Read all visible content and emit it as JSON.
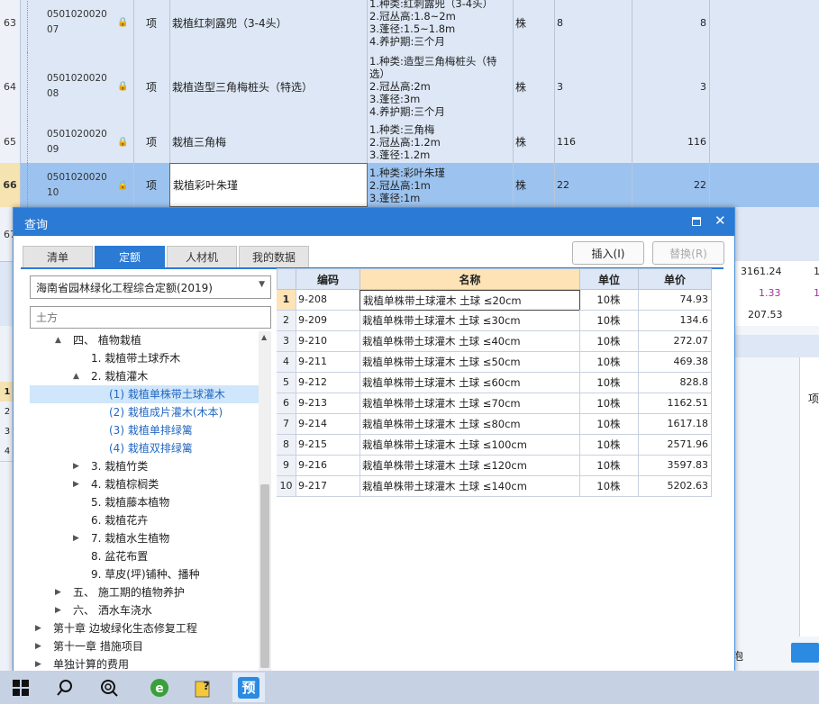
{
  "bg_rows": [
    {
      "num": "63",
      "code": "050102002007",
      "type": "项",
      "name": "栽植红刺露兜（3-4头）",
      "features": [
        "1.种类:红刺露兜（3-4头）",
        "2.冠丛高:1.8~2m",
        "3.蓬径:1.5~1.8m",
        "4.养护期:三个月"
      ],
      "unit": "株",
      "qty1": "8",
      "qty2": "8"
    },
    {
      "num": "64",
      "code": "050102002008",
      "type": "项",
      "name": "栽植造型三角梅桩头（特选）",
      "features": [
        "1.种类:造型三角梅桩头（特",
        "选）",
        "2.冠丛高:2m",
        "3.蓬径:3m",
        "4.养护期:三个月"
      ],
      "unit": "株",
      "qty1": "3",
      "qty2": "3"
    },
    {
      "num": "65",
      "code": "050102002009",
      "type": "项",
      "name": "栽植三角梅",
      "features": [
        "1.种类:三角梅",
        "2.冠丛高:1.2m",
        "3.蓬径:1.2m"
      ],
      "unit": "株",
      "qty1": "116",
      "qty2": "116"
    },
    {
      "num": "66",
      "code": "050102002010",
      "type": "项",
      "name": "栽植彩叶朱瑾",
      "features": [
        "1.种类:彩叶朱瑾",
        "2.冠丛高:1m",
        "3.蓬径:1m"
      ],
      "unit": "株",
      "qty1": "22",
      "qty2": "22"
    }
  ],
  "bg_partial": {
    "row67": "67",
    "right_vals": [
      "3161.24",
      "1.33",
      "207.53"
    ],
    "right_extra": [
      "1",
      "1"
    ],
    "left_nums": [
      "1",
      "2",
      "3",
      "4"
    ],
    "right_label_1": "项",
    "right_label_2": "泡"
  },
  "dialog": {
    "title": "查询",
    "tabs": [
      "清单",
      "定额",
      "人材机",
      "我的数据"
    ],
    "active_tab": "定额",
    "insert_label": "插入(I)",
    "replace_label": "替换(R)",
    "quota_select": "海南省园林绿化工程综合定额(2019)",
    "search_value": "",
    "search_placeholder": "土方",
    "tree": [
      {
        "label": "四、 植物栽植",
        "level": 2,
        "exp": "▲"
      },
      {
        "label": "1. 栽植带土球乔木",
        "level": 3,
        "exp": ""
      },
      {
        "label": "2. 栽植灌木",
        "level": 3,
        "exp": "▲"
      },
      {
        "label": "(1) 栽植单株带土球灌木",
        "level": 4,
        "exp": "",
        "selected": true
      },
      {
        "label": "(2) 栽植成片灌木(木本)",
        "level": 4,
        "exp": ""
      },
      {
        "label": "(3) 栽植单排绿篱",
        "level": 4,
        "exp": ""
      },
      {
        "label": "(4) 栽植双排绿篱",
        "level": 4,
        "exp": ""
      },
      {
        "label": "3. 栽植竹类",
        "level": 3,
        "exp": "▶"
      },
      {
        "label": "4. 栽植棕榈类",
        "level": 3,
        "exp": "▶"
      },
      {
        "label": "5. 栽植藤本植物",
        "level": 3,
        "exp": ""
      },
      {
        "label": "6. 栽植花卉",
        "level": 3,
        "exp": ""
      },
      {
        "label": "7. 栽植水生植物",
        "level": 3,
        "exp": "▶"
      },
      {
        "label": "8. 盆花布置",
        "level": 3,
        "exp": ""
      },
      {
        "label": "9. 草皮(坪)铺种、播种",
        "level": 3,
        "exp": ""
      },
      {
        "label": "五、 施工期的植物养护",
        "level": 2,
        "exp": "▶"
      },
      {
        "label": "六、 洒水车浇水",
        "level": 2,
        "exp": "▶"
      },
      {
        "label": "第十章 边坡绿化生态修复工程",
        "level": 1,
        "exp": "▶"
      },
      {
        "label": "第十一章 措施项目",
        "level": 1,
        "exp": "▶"
      },
      {
        "label": "单独计算的费用",
        "level": 1,
        "exp": "▶"
      }
    ],
    "grid_headers": {
      "code": "编码",
      "name": "名称",
      "unit": "单位",
      "price": "单价"
    },
    "grid_rows": [
      {
        "idx": "1",
        "code": "9-208",
        "name": "栽植单株带土球灌木 土球 ≤20cm",
        "unit": "10株",
        "price": "74.93"
      },
      {
        "idx": "2",
        "code": "9-209",
        "name": "栽植单株带土球灌木 土球 ≤30cm",
        "unit": "10株",
        "price": "134.6"
      },
      {
        "idx": "3",
        "code": "9-210",
        "name": "栽植单株带土球灌木 土球 ≤40cm",
        "unit": "10株",
        "price": "272.07"
      },
      {
        "idx": "4",
        "code": "9-211",
        "name": "栽植单株带土球灌木 土球 ≤50cm",
        "unit": "10株",
        "price": "469.38"
      },
      {
        "idx": "5",
        "code": "9-212",
        "name": "栽植单株带土球灌木 土球 ≤60cm",
        "unit": "10株",
        "price": "828.8"
      },
      {
        "idx": "6",
        "code": "9-213",
        "name": "栽植单株带土球灌木 土球 ≤70cm",
        "unit": "10株",
        "price": "1162.51"
      },
      {
        "idx": "7",
        "code": "9-214",
        "name": "栽植单株带土球灌木 土球 ≤80cm",
        "unit": "10株",
        "price": "1617.18"
      },
      {
        "idx": "8",
        "code": "9-215",
        "name": "栽植单株带土球灌木 土球 ≤100cm",
        "unit": "10株",
        "price": "2571.96"
      },
      {
        "idx": "9",
        "code": "9-216",
        "name": "栽植单株带土球灌木 土球 ≤120cm",
        "unit": "10株",
        "price": "3597.83"
      },
      {
        "idx": "10",
        "code": "9-217",
        "name": "栽植单株带土球灌木 土球 ≤140cm",
        "unit": "10株",
        "price": "5202.63"
      }
    ]
  },
  "taskbar": {
    "icons": [
      "windows-start",
      "search",
      "cortana",
      "browser-e",
      "help",
      "yu-app"
    ],
    "app_glyph": "预"
  },
  "colors": {
    "accent": "#2b7ad4",
    "row_bg": "#dde7f5",
    "selected_row": "#9cc3ef",
    "header_orange": "#fde3b6"
  }
}
